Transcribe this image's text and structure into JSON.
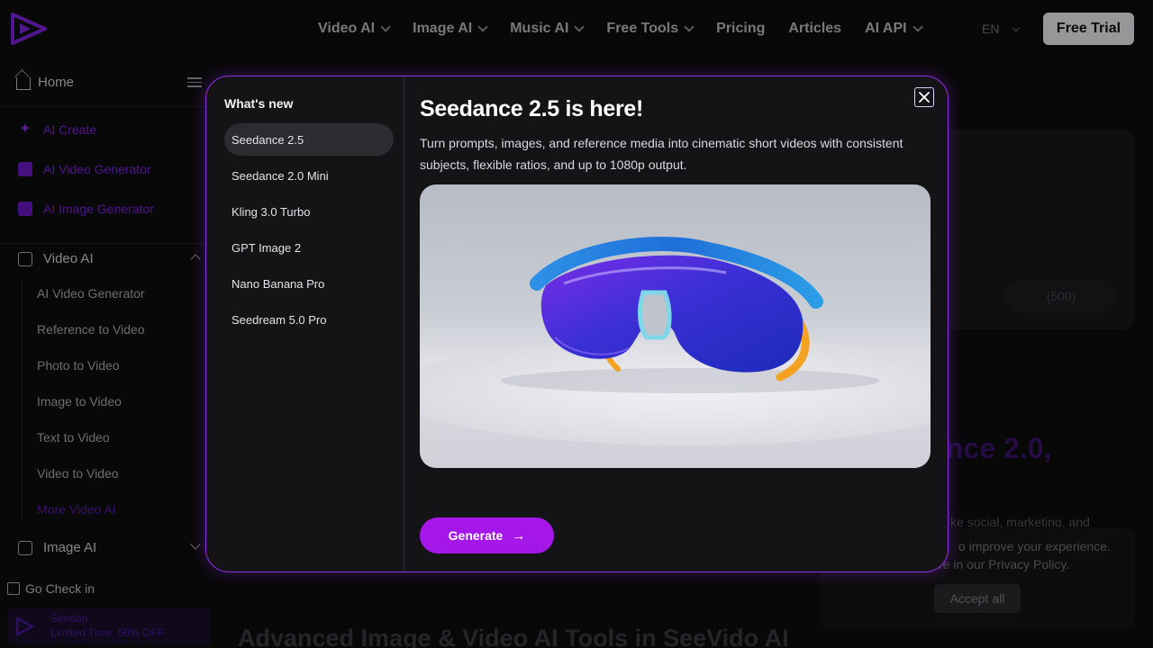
{
  "nav": {
    "items": [
      {
        "label": "Video AI",
        "dropdown": true
      },
      {
        "label": "Image AI",
        "dropdown": true
      },
      {
        "label": "Music AI",
        "dropdown": true
      },
      {
        "label": "Free Tools",
        "dropdown": true
      },
      {
        "label": "Pricing",
        "dropdown": false
      },
      {
        "label": "Articles",
        "dropdown": false
      },
      {
        "label": "AI API",
        "dropdown": true
      }
    ],
    "language": "EN",
    "cta": "Free Trial"
  },
  "sidebar": {
    "home": "Home",
    "links": [
      {
        "label": "AI Create",
        "icon": "sparkle-icon"
      },
      {
        "label": "AI Video Generator",
        "icon": "video-square-icon"
      },
      {
        "label": "AI Image Generator",
        "icon": "image-square-icon"
      }
    ],
    "video_section": "Video AI",
    "video_items": [
      "AI Video Generator",
      "Reference to Video",
      "Photo to Video",
      "Image to Video",
      "Text to Video",
      "Video to Video",
      "More Video AI"
    ],
    "image_section": "Image AI",
    "checkin": "Go Check in",
    "promo": {
      "line1": "Seedan",
      "line2": "Limited Time: 50% OFF"
    }
  },
  "background": {
    "credits": "(500)",
    "heading_partial": "nce 2.0,",
    "text_partial": "ke social, marketing, and",
    "bottom_heading": "Advanced Image & Video AI Tools in SeeVido AI"
  },
  "cookie": {
    "line1": "o improve your experience.",
    "line2": "re in our Privacy Policy.",
    "accept": "Accept all"
  },
  "modal": {
    "whats_new": "What's new",
    "items": [
      "Seedance 2.5",
      "Seedance 2.0 Mini",
      "Kling 3.0 Turbo",
      "GPT Image 2",
      "Nano Banana Pro",
      "Seedream 5.0 Pro"
    ],
    "active_index": 0,
    "title": "Seedance 2.5 is here!",
    "description": "Turn prompts, images, and reference media into cinematic short videos with consistent subjects, flexible ratios, and up to 1080p output.",
    "image_alt": "sport sunglasses",
    "generate": "Generate",
    "accent": "#a516e8"
  }
}
